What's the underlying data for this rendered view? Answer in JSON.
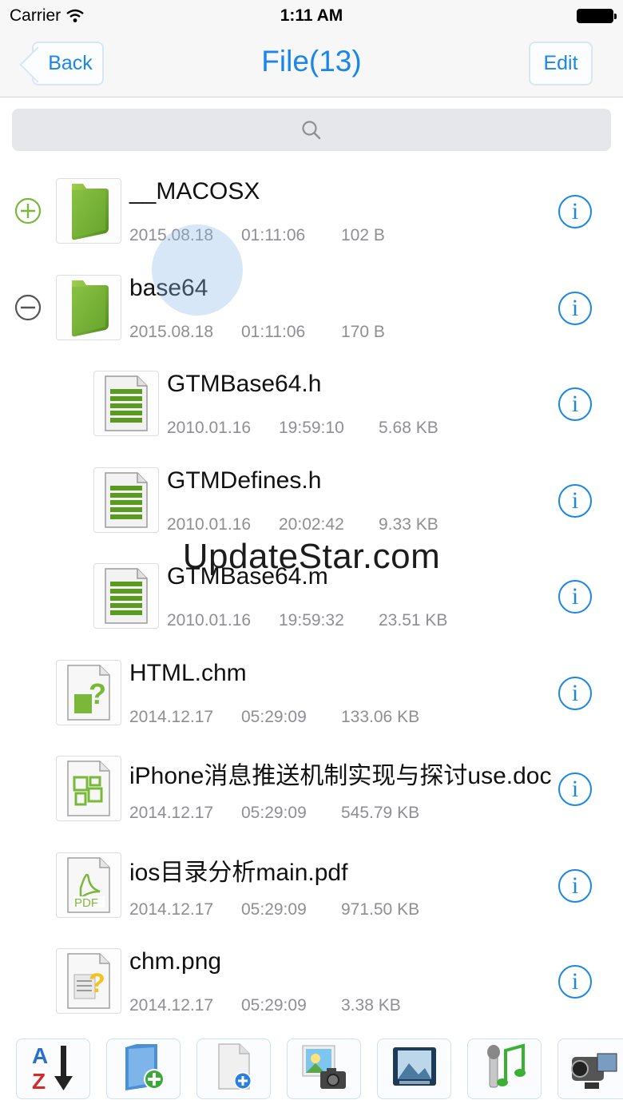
{
  "status_bar": {
    "carrier": "Carrier",
    "time": "1:11 AM"
  },
  "nav": {
    "back_label": "Back",
    "title": "File(13)",
    "edit_label": "Edit"
  },
  "search": {
    "icon": "search-icon"
  },
  "files": [
    {
      "name": "__MACOSX",
      "date": "2015.08.18",
      "time": "01:11:06",
      "size": "102 B",
      "type": "folder",
      "expander": "plus",
      "indent": 0
    },
    {
      "name": "base64",
      "date": "2015.08.18",
      "time": "01:11:06",
      "size": "170 B",
      "type": "folder",
      "expander": "minus",
      "indent": 0
    },
    {
      "name": "GTMBase64.h",
      "date": "2010.01.16",
      "time": "19:59:10",
      "size": "5.68 KB",
      "type": "text",
      "indent": 1
    },
    {
      "name": "GTMDefines.h",
      "date": "2010.01.16",
      "time": "20:02:42",
      "size": "9.33 KB",
      "type": "text",
      "indent": 1
    },
    {
      "name": "GTMBase64.m",
      "date": "2010.01.16",
      "time": "19:59:32",
      "size": "23.51 KB",
      "type": "text",
      "indent": 1
    },
    {
      "name": "HTML.chm",
      "date": "2014.12.17",
      "time": "05:29:09",
      "size": "133.06 KB",
      "type": "chm",
      "indent": 0
    },
    {
      "name": "iPhone消息推送机制实现与探讨use.doc",
      "date": "2014.12.17",
      "time": "05:29:09",
      "size": "545.79 KB",
      "type": "doc",
      "indent": 0
    },
    {
      "name": "ios目录分析main.pdf",
      "date": "2014.12.17",
      "time": "05:29:09",
      "size": "971.50 KB",
      "type": "pdf",
      "indent": 0
    },
    {
      "name": "chm.png",
      "date": "2014.12.17",
      "time": "05:29:09",
      "size": "3.38 KB",
      "type": "image",
      "indent": 0
    }
  ],
  "watermark": "UpdateStar.com",
  "toolbar": [
    {
      "icon": "sort-az-icon"
    },
    {
      "icon": "new-folder-icon"
    },
    {
      "icon": "new-file-icon"
    },
    {
      "icon": "photo-import-icon"
    },
    {
      "icon": "gallery-book-icon"
    },
    {
      "icon": "audio-record-icon"
    },
    {
      "icon": "video-camera-icon"
    }
  ],
  "colors": {
    "accent": "#1a86e8",
    "folder_green": "#7ab83a",
    "meta_gray": "#8e8e93"
  }
}
